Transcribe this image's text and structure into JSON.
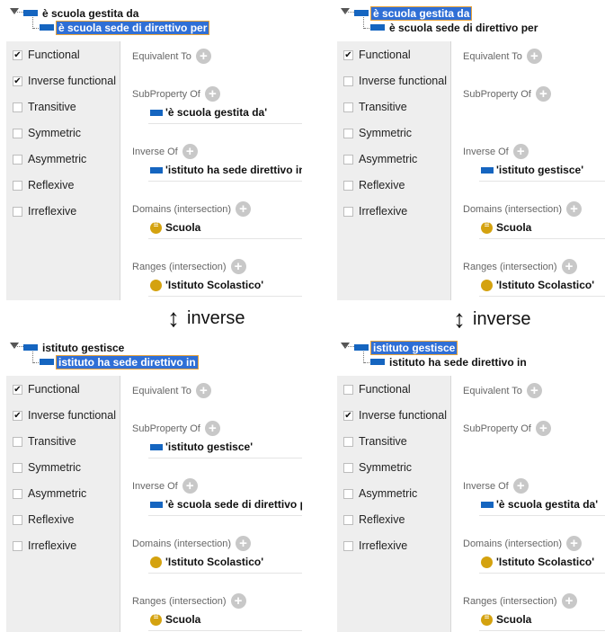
{
  "characteristics": [
    "Functional",
    "Inverse functional",
    "Transitive",
    "Symmetric",
    "Asymmetric",
    "Reflexive",
    "Irreflexive"
  ],
  "section_labels": {
    "equivalent_to": "Equivalent To",
    "subproperty_of": "SubProperty Of",
    "inverse_of": "Inverse Of",
    "domains": "Domains (intersection)",
    "ranges": "Ranges (intersection)"
  },
  "add_icon": "plus-circle-icon",
  "between_label": "inverse",
  "between_icon": "up-down-arrow-icon",
  "colors": {
    "property_bar": "#1565c0",
    "class_circle": "#d4a20f",
    "selection": "#2f6fd6",
    "selection_border": "#e8a33a"
  },
  "panels": [
    {
      "tree": {
        "parent": "è scuola gestita da",
        "child": "è scuola sede di direttivo per",
        "selected": "child"
      },
      "checked": [
        true,
        true,
        false,
        false,
        false,
        false,
        false
      ],
      "subproperty_of": "'è scuola gestita da'",
      "inverse_of": "'istituto ha sede direttivo in'",
      "domain": {
        "label": "Scuola",
        "icon": "defined-class-icon"
      },
      "range": {
        "label": "'Istituto Scolastico'",
        "icon": "class-icon"
      }
    },
    {
      "tree": {
        "parent": "è scuola gestita da",
        "child": "è scuola sede di direttivo per",
        "selected": "parent"
      },
      "checked": [
        true,
        false,
        false,
        false,
        false,
        false,
        false
      ],
      "subproperty_of": "",
      "inverse_of": "'istituto gestisce'",
      "domain": {
        "label": "Scuola",
        "icon": "defined-class-icon"
      },
      "range": {
        "label": "'Istituto Scolastico'",
        "icon": "class-icon"
      }
    },
    {
      "tree": {
        "parent": "istituto gestisce",
        "child": "istituto ha sede direttivo in",
        "selected": "child"
      },
      "checked": [
        true,
        true,
        false,
        false,
        false,
        false,
        false
      ],
      "subproperty_of": "'istituto gestisce'",
      "inverse_of": "'è scuola sede di direttivo per'",
      "domain": {
        "label": "'Istituto Scolastico'",
        "icon": "class-icon"
      },
      "range": {
        "label": "Scuola",
        "icon": "defined-class-icon"
      }
    },
    {
      "tree": {
        "parent": "istituto gestisce",
        "child": "istituto ha sede direttivo in",
        "selected": "parent"
      },
      "checked": [
        false,
        true,
        false,
        false,
        false,
        false,
        false
      ],
      "subproperty_of": "",
      "inverse_of": "'è scuola gestita da'",
      "domain": {
        "label": "'Istituto Scolastico'",
        "icon": "class-icon"
      },
      "range": {
        "label": "Scuola",
        "icon": "defined-class-icon"
      }
    }
  ]
}
